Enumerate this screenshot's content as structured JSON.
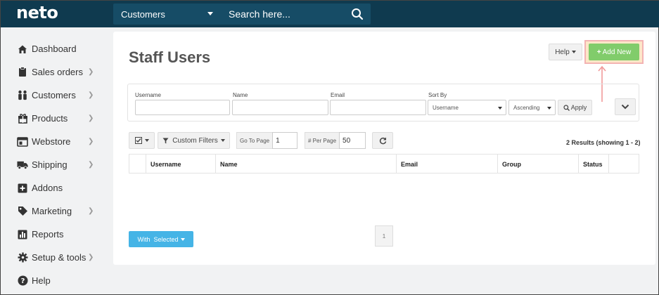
{
  "brand": {
    "logo": "neto"
  },
  "search": {
    "scope": "Customers",
    "placeholder": "Search here..."
  },
  "sidebar": {
    "items": [
      {
        "label": "Dashboard",
        "icon": "home-icon",
        "has_children": false
      },
      {
        "label": "Sales orders",
        "icon": "clipboard-icon",
        "has_children": true
      },
      {
        "label": "Customers",
        "icon": "people-icon",
        "has_children": true
      },
      {
        "label": "Products",
        "icon": "gift-icon",
        "has_children": true
      },
      {
        "label": "Webstore",
        "icon": "browser-icon",
        "has_children": true
      },
      {
        "label": "Shipping",
        "icon": "truck-icon",
        "has_children": true
      },
      {
        "label": "Addons",
        "icon": "plus-square-icon",
        "has_children": false
      },
      {
        "label": "Marketing",
        "icon": "tag-icon",
        "has_children": true
      },
      {
        "label": "Reports",
        "icon": "chart-icon",
        "has_children": false
      },
      {
        "label": "Setup & tools",
        "icon": "gear-icon",
        "has_children": true
      },
      {
        "label": "Help",
        "icon": "help-circle-icon",
        "has_children": false
      }
    ]
  },
  "page": {
    "title": "Staff Users",
    "help_label": "Help",
    "add_new_label": "Add New"
  },
  "filters": {
    "username_label": "Username",
    "name_label": "Name",
    "email_label": "Email",
    "sort_by_label": "Sort By",
    "sort_field": "Username",
    "sort_order": "Ascending",
    "apply_label": "Apply"
  },
  "toolbar": {
    "custom_filters_label": "Custom Filters",
    "go_to_page_label": "Go To Page",
    "go_to_page_value": "1",
    "per_page_label": "# Per Page",
    "per_page_value": "50",
    "results_text": "2 Results (showing 1 - 2)"
  },
  "table": {
    "columns": [
      "Username",
      "Name",
      "Email",
      "Group",
      "Status"
    ]
  },
  "footer": {
    "with_selected_label": "With  Selected",
    "page_number": "1"
  },
  "colors": {
    "topbar": "#0f3a4f",
    "add_button": "#81cc6b",
    "with_selected": "#45b4e6",
    "highlight_border": "#f3b3b3"
  }
}
